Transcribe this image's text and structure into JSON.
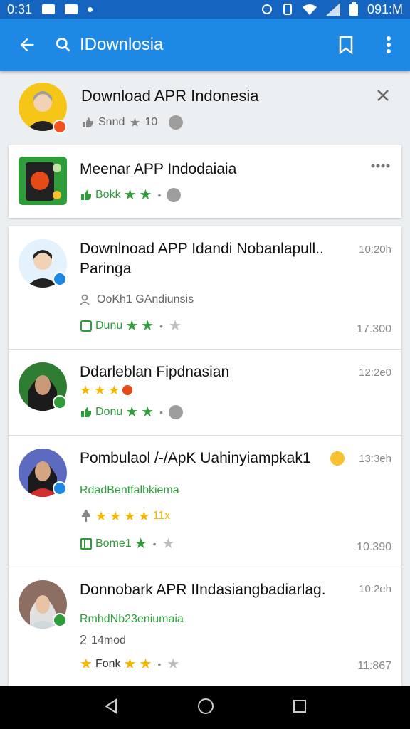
{
  "status": {
    "time": "0:31",
    "right_time": "091:M"
  },
  "appbar": {
    "search_text": "IDownlosia"
  },
  "featured": {
    "title": "Download APR Indonesia",
    "meta_text": "Snnd",
    "rating_text": "10"
  },
  "app_card": {
    "title": "Meenar APP Indodaiaia",
    "meta_label": "Bokk"
  },
  "items": [
    {
      "title": "Downlnoad APP Idandi Nobanlapull..",
      "title2": "Paringa",
      "time": "10:20h",
      "subtitle": "OoKh1 GAndiunsis",
      "meta_label": "Dunu",
      "count": "17.300"
    },
    {
      "title": "Ddarleblan Fipdnasian",
      "time": "12:2e0",
      "meta_label": "Donu"
    },
    {
      "title": "Pombulaol /-/ApK Uahinyiampkak1",
      "time": "13:3eh",
      "subtitle": "RdadBentfalbkiema",
      "rating_suffix": "11x",
      "meta_label": "Bome1",
      "count": "10.390"
    },
    {
      "title": "Donnobark APR IIndasiangbadiarlag.",
      "time": "10:2eh",
      "subtitle": "RmhdNb23eniumaia",
      "author": "14mod",
      "meta_label": "Fonk",
      "count": "11:867"
    }
  ],
  "colors": {
    "appbar": "#1e88e5",
    "statusbar": "#1565c0",
    "green": "#2e9d3a",
    "star_yellow": "#f5b400"
  }
}
